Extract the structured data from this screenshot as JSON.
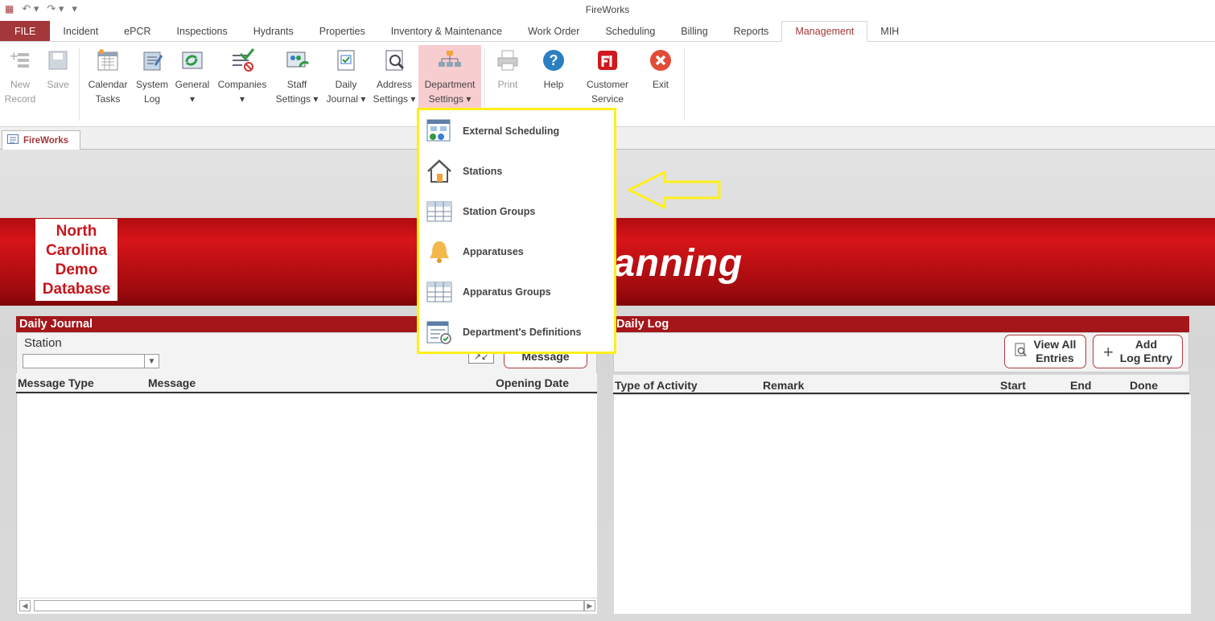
{
  "app": {
    "title": "FireWorks"
  },
  "ribbon_tabs": [
    "FILE",
    "Incident",
    "ePCR",
    "Inspections",
    "Hydrants",
    "Properties",
    "Inventory & Maintenance",
    "Work Order",
    "Scheduling",
    "Billing",
    "Reports",
    "Management",
    "MIH"
  ],
  "active_tab": "Management",
  "ribbon": {
    "new_record": [
      "New",
      "Record"
    ],
    "save": [
      "Save",
      ""
    ],
    "calendar_tasks": [
      "Calendar",
      "Tasks"
    ],
    "system_log": [
      "System",
      "Log"
    ],
    "general": [
      "General",
      "▾"
    ],
    "companies": [
      "Companies",
      "▾"
    ],
    "staff_settings": [
      "Staff",
      "Settings ▾"
    ],
    "daily_journal": [
      "Daily",
      "Journal ▾"
    ],
    "address_settings": [
      "Address",
      "Settings ▾"
    ],
    "department_settings": [
      "Department",
      "Settings ▾"
    ],
    "print": [
      "Print",
      ""
    ],
    "help": [
      "Help",
      ""
    ],
    "customer_service": [
      "Customer",
      "Service"
    ],
    "exit": [
      "Exit",
      ""
    ]
  },
  "document_tab": "FireWorks",
  "logo": {
    "line1": "North",
    "line2": "Carolina",
    "line3": "Demo",
    "line4": "Database"
  },
  "banner_title": "s - Ryan Fanning",
  "daily_journal": {
    "header": "Daily Journal",
    "station_label": "Station",
    "station_value": "",
    "message_button": "Message",
    "columns": [
      "Message Type",
      "Message",
      "Opening Date"
    ]
  },
  "daily_log": {
    "header": "Daily Log",
    "view_all_line1": "View All",
    "view_all_line2": "Entries",
    "add_line1": "Add",
    "add_line2": "Log Entry",
    "columns": [
      "Type of Activity",
      "Remark",
      "Start",
      "End",
      "Done"
    ]
  },
  "department_menu": [
    {
      "label": "External Scheduling",
      "icon": "external-scheduling-icon"
    },
    {
      "label": "Stations",
      "icon": "house-icon"
    },
    {
      "label": "Station Groups",
      "icon": "grid-icon"
    },
    {
      "label": "Apparatuses",
      "icon": "bell-icon"
    },
    {
      "label": "Apparatus Groups",
      "icon": "grid-icon"
    },
    {
      "label": "Department's Definitions",
      "icon": "definitions-icon"
    }
  ],
  "colors": {
    "accent": "#a4373a",
    "banner": "#c7161c",
    "highlight": "#ffef1a",
    "menu_hover": "#f7cdd0"
  }
}
